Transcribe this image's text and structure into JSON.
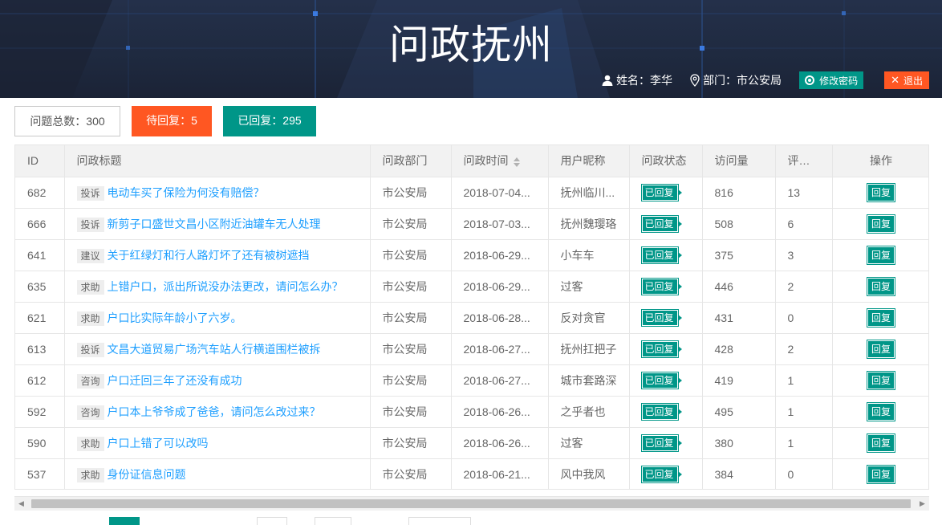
{
  "header": {
    "title": "问政抚州",
    "user_label": "姓名：李华",
    "dept_label": "部门：市公安局",
    "change_password": "修改密码",
    "logout": "退出"
  },
  "stats": {
    "total": "问题总数：300",
    "pending": "待回复：5",
    "replied": "已回复：295"
  },
  "table": {
    "columns": [
      "ID",
      "问政标题",
      "问政部门",
      "问政时间",
      "用户昵称",
      "问政状态",
      "访问量",
      "评论数",
      "操作"
    ],
    "rows": [
      {
        "id": "682",
        "cat": "投诉",
        "title": "电动车买了保险为何没有赔偿？",
        "dept": "市公安局",
        "time": "2018-07-04...",
        "user": "抚州临川...",
        "status": "已回复",
        "views": "816",
        "comments": "13",
        "op": "回复"
      },
      {
        "id": "666",
        "cat": "投诉",
        "title": "新剪子口盛世文昌小区附近油罐车无人处理",
        "dept": "市公安局",
        "time": "2018-07-03...",
        "user": "抚州魏璎珞",
        "status": "已回复",
        "views": "508",
        "comments": "6",
        "op": "回复"
      },
      {
        "id": "641",
        "cat": "建议",
        "title": "关于红绿灯和行人路灯坏了还有被树遮挡",
        "dept": "市公安局",
        "time": "2018-06-29...",
        "user": "小车车",
        "status": "已回复",
        "views": "375",
        "comments": "3",
        "op": "回复"
      },
      {
        "id": "635",
        "cat": "求助",
        "title": "上错户口，派出所说没办法更改，请问怎么办？",
        "dept": "市公安局",
        "time": "2018-06-29...",
        "user": "过客",
        "status": "已回复",
        "views": "446",
        "comments": "2",
        "op": "回复"
      },
      {
        "id": "621",
        "cat": "求助",
        "title": "户口比实际年龄小了六岁。",
        "dept": "市公安局",
        "time": "2018-06-28...",
        "user": "反对贪官",
        "status": "已回复",
        "views": "431",
        "comments": "0",
        "op": "回复"
      },
      {
        "id": "613",
        "cat": "投诉",
        "title": "文昌大道贸易广场汽车站人行横道围栏被拆",
        "dept": "市公安局",
        "time": "2018-06-27...",
        "user": "抚州扛把子",
        "status": "已回复",
        "views": "428",
        "comments": "2",
        "op": "回复"
      },
      {
        "id": "612",
        "cat": "咨询",
        "title": "户口迁回三年了还没有成功",
        "dept": "市公安局",
        "time": "2018-06-27...",
        "user": "城市套路深",
        "status": "已回复",
        "views": "419",
        "comments": "1",
        "op": "回复"
      },
      {
        "id": "592",
        "cat": "咨询",
        "title": "户口本上爷爷成了爸爸，请问怎么改过来？",
        "dept": "市公安局",
        "time": "2018-06-26...",
        "user": "之乎者也",
        "status": "已回复",
        "views": "495",
        "comments": "1",
        "op": "回复"
      },
      {
        "id": "590",
        "cat": "求助",
        "title": "户口上错了可以改吗",
        "dept": "市公安局",
        "time": "2018-06-26...",
        "user": "过客",
        "status": "已回复",
        "views": "380",
        "comments": "1",
        "op": "回复"
      },
      {
        "id": "537",
        "cat": "求助",
        "title": "身份证信息问题",
        "dept": "市公安局",
        "time": "2018-06-21...",
        "user": "风中我风",
        "status": "已回复",
        "views": "384",
        "comments": "0",
        "op": "回复"
      }
    ]
  },
  "icons": {
    "user": "user-icon",
    "location": "location-pin-icon",
    "password": "target-icon",
    "logout": "close-icon",
    "sort": "sort-icon",
    "scroll_left": "arrow-left-icon",
    "scroll_right": "arrow-right-icon"
  },
  "colors": {
    "primary": "#009688",
    "danger": "#ff5722",
    "link": "#1e9fff",
    "header_bg": "#1f2a40"
  }
}
